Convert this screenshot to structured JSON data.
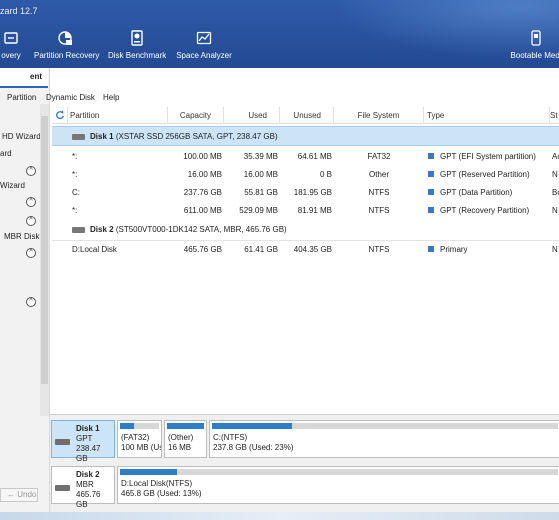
{
  "app": {
    "title_fragment": "zard 12.7"
  },
  "toolbar": {
    "items": [
      {
        "label": "overy",
        "icon": "data-recovery-icon"
      },
      {
        "label": "Partition Recovery",
        "icon": "partition-recovery-icon"
      },
      {
        "label": "Disk Benchmark",
        "icon": "disk-benchmark-icon"
      },
      {
        "label": "Space Analyzer",
        "icon": "space-analyzer-icon"
      },
      {
        "label": "Bootable Medi",
        "icon": "bootable-media-icon"
      }
    ]
  },
  "left_panel": {
    "tab_label": "ent",
    "items": [
      "HD Wizard",
      "ard",
      "Wizard",
      "MBR Disk"
    ],
    "undo_label": "Undo"
  },
  "menubar": {
    "items": [
      "Partition",
      "Dynamic Disk",
      "Help"
    ]
  },
  "table": {
    "columns": [
      "Partition",
      "Capacity",
      "Used",
      "Unused",
      "File System",
      "Type",
      "St"
    ],
    "disks": [
      {
        "header": "Disk 1",
        "detail": "(XSTAR SSD 256GB SATA, GPT, 238.47 GB)",
        "rows": [
          {
            "partition": "*:",
            "capacity": "100.00 MB",
            "used": "35.39 MB",
            "unused": "64.61 MB",
            "fs": "FAT32",
            "type": "GPT (EFI System partition)",
            "status": "Ac"
          },
          {
            "partition": "*:",
            "capacity": "16.00 MB",
            "used": "16.00 MB",
            "unused": "0 B",
            "fs": "Other",
            "type": "GPT (Reserved Partition)",
            "status": "N"
          },
          {
            "partition": "C:",
            "capacity": "237.76 GB",
            "used": "55.81 GB",
            "unused": "181.95 GB",
            "fs": "NTFS",
            "type": "GPT (Data Partition)",
            "status": "Bo"
          },
          {
            "partition": "*:",
            "capacity": "611.00 MB",
            "used": "529.09 MB",
            "unused": "81.91 MB",
            "fs": "NTFS",
            "type": "GPT (Recovery Partition)",
            "status": "N"
          }
        ]
      },
      {
        "header": "Disk 2",
        "detail": "(ST500VT000-1DK142 SATA, MBR, 465.76 GB)",
        "rows": [
          {
            "partition": "D:Local Disk",
            "capacity": "465.76 GB",
            "used": "61.41 GB",
            "unused": "404.35 GB",
            "fs": "NTFS",
            "type": "Primary",
            "status": "N"
          }
        ]
      }
    ]
  },
  "disk_map": [
    {
      "name": "Disk 1",
      "scheme": "GPT",
      "size": "238.47 GB",
      "partitions": [
        {
          "line1": "(FAT32)",
          "line2": "100 MB (Us",
          "used_fraction": 0.35
        },
        {
          "line1": "(Other)",
          "line2": "16 MB",
          "used_fraction": 1.0
        },
        {
          "line1": "C:(NTFS)",
          "line2": "237.8 GB (Used: 23%)",
          "used_fraction": 0.23
        }
      ]
    },
    {
      "name": "Disk 2",
      "scheme": "MBR",
      "size": "465.76 GB",
      "partitions": [
        {
          "line1": "D:Local Disk(NTFS)",
          "line2": "465.8 GB (Used: 13%)",
          "used_fraction": 0.13
        }
      ]
    }
  ],
  "colors": {
    "ribbon": "#2f5aa8",
    "selection": "#cde4f7",
    "usage_fill": "#2f7cc8",
    "type_square": "#3a78c2"
  }
}
